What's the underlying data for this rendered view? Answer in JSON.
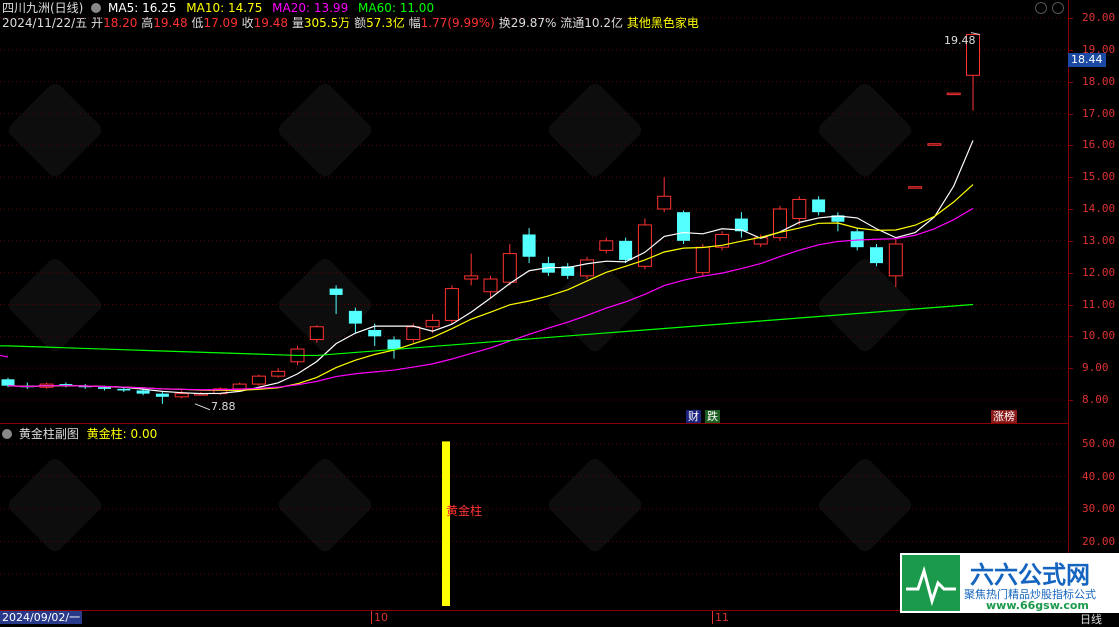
{
  "header": {
    "stock_name": "四川九洲(日线)",
    "ma5_label": "MA5: 16.25",
    "ma10_label": "MA10: 14.75",
    "ma20_label": "MA20: 13.99",
    "ma60_label": "MA60: 11.00",
    "date": "2024/11/22/五",
    "open_label": "开",
    "open": "18.20",
    "high_label": "高",
    "high": "19.48",
    "low_label": "低",
    "low": "17.09",
    "close_label": "收",
    "close": "19.48",
    "volume_label": "量",
    "volume": "305.5万",
    "amount_label": "额",
    "amount": "57.3亿",
    "change_label": "幅",
    "change": "1.77(9.99%)",
    "turnover": "换29.87%",
    "float_cap": "流通10.2亿",
    "sector": "其他黑色家电"
  },
  "price_axis": {
    "ticks": [
      "20.00",
      "19.00",
      "18.00",
      "17.00",
      "16.00",
      "15.00",
      "14.00",
      "13.00",
      "12.00",
      "11.00",
      "10.00",
      "9.00",
      "8.00"
    ],
    "current_price_box": "18.44"
  },
  "annotations": {
    "high_mark": "19.48",
    "low_mark": "7.88",
    "tag_cai": "财",
    "tag_die": "跌",
    "tag_zhangbang": "涨榜"
  },
  "sub_panel": {
    "title": "黄金柱副图",
    "indicator_label": "黄金柱: 0.00",
    "bar_label": "黄金柱",
    "ticks": [
      "50.00",
      "40.00",
      "30.00",
      "20.00",
      "10.00"
    ]
  },
  "time_axis": {
    "start_date": "2024/09/02/一",
    "month_10": "10",
    "month_11": "11",
    "period": "日线"
  },
  "logo": {
    "brand": "六六公式网",
    "slogan": "聚焦热门精品炒股指标公式",
    "url": "www.66gsw.com"
  },
  "colors": {
    "up": "#ff3232",
    "down": "#54ffff",
    "ma5": "#ffffff",
    "ma10": "#ffff00",
    "ma20": "#ff00ff",
    "ma60": "#00ff00"
  },
  "candles": [
    [
      8.65,
      8.45,
      8.7,
      8.4
    ],
    [
      8.45,
      8.4,
      8.55,
      8.35
    ],
    [
      8.4,
      8.5,
      8.55,
      8.35
    ],
    [
      8.5,
      8.45,
      8.55,
      8.4
    ],
    [
      8.45,
      8.4,
      8.5,
      8.35
    ],
    [
      8.4,
      8.35,
      8.45,
      8.3
    ],
    [
      8.35,
      8.3,
      8.4,
      8.25
    ],
    [
      8.3,
      8.2,
      8.35,
      8.15
    ],
    [
      8.2,
      8.1,
      8.25,
      7.88
    ],
    [
      8.1,
      8.2,
      8.3,
      8.05
    ],
    [
      8.2,
      8.2,
      8.25,
      8.15
    ],
    [
      8.2,
      8.35,
      8.4,
      8.15
    ],
    [
      8.35,
      8.5,
      8.55,
      8.3
    ],
    [
      8.5,
      8.75,
      8.8,
      8.45
    ],
    [
      8.75,
      8.9,
      9.0,
      8.7
    ],
    [
      9.2,
      9.6,
      9.7,
      9.1
    ],
    [
      9.9,
      10.3,
      10.35,
      9.8
    ],
    [
      11.5,
      11.3,
      11.6,
      10.7
    ],
    [
      10.8,
      10.4,
      10.9,
      10.1
    ],
    [
      10.2,
      10.0,
      10.4,
      9.7
    ],
    [
      9.9,
      9.6,
      10.0,
      9.3
    ],
    [
      9.9,
      10.3,
      10.4,
      9.8
    ],
    [
      10.3,
      10.5,
      10.7,
      10.1
    ],
    [
      10.5,
      11.5,
      11.6,
      10.4
    ],
    [
      11.8,
      11.9,
      12.6,
      11.6
    ],
    [
      11.4,
      11.8,
      11.9,
      11.2
    ],
    [
      11.7,
      12.6,
      12.9,
      11.6
    ],
    [
      13.2,
      12.5,
      13.4,
      12.3
    ],
    [
      12.3,
      12.0,
      12.5,
      11.9
    ],
    [
      12.2,
      11.9,
      12.3,
      11.8
    ],
    [
      11.9,
      12.4,
      12.5,
      11.8
    ],
    [
      12.7,
      13.0,
      13.1,
      12.6
    ],
    [
      13.0,
      12.4,
      13.1,
      12.3
    ],
    [
      12.2,
      13.5,
      13.7,
      12.1
    ],
    [
      14.0,
      14.4,
      15.0,
      13.9
    ],
    [
      13.9,
      13.0,
      13.95,
      12.9
    ],
    [
      12.0,
      12.8,
      12.9,
      11.9
    ],
    [
      12.8,
      13.2,
      13.3,
      12.7
    ],
    [
      13.7,
      13.3,
      13.9,
      13.1
    ],
    [
      12.9,
      13.1,
      13.2,
      12.8
    ],
    [
      13.1,
      14.0,
      14.1,
      13.0
    ],
    [
      13.7,
      14.3,
      14.4,
      13.5
    ],
    [
      14.3,
      13.9,
      14.4,
      13.8
    ],
    [
      13.8,
      13.6,
      13.9,
      13.3
    ],
    [
      13.3,
      12.8,
      13.4,
      12.7
    ],
    [
      12.8,
      12.3,
      12.9,
      12.2
    ],
    [
      11.9,
      12.9,
      13.1,
      11.55
    ],
    [
      14.7,
      14.7,
      14.7,
      14.7
    ],
    [
      16.05,
      16.05,
      16.05,
      16.05
    ],
    [
      17.64,
      17.64,
      17.64,
      17.64
    ],
    [
      18.2,
      19.48,
      19.48,
      17.09
    ]
  ]
}
